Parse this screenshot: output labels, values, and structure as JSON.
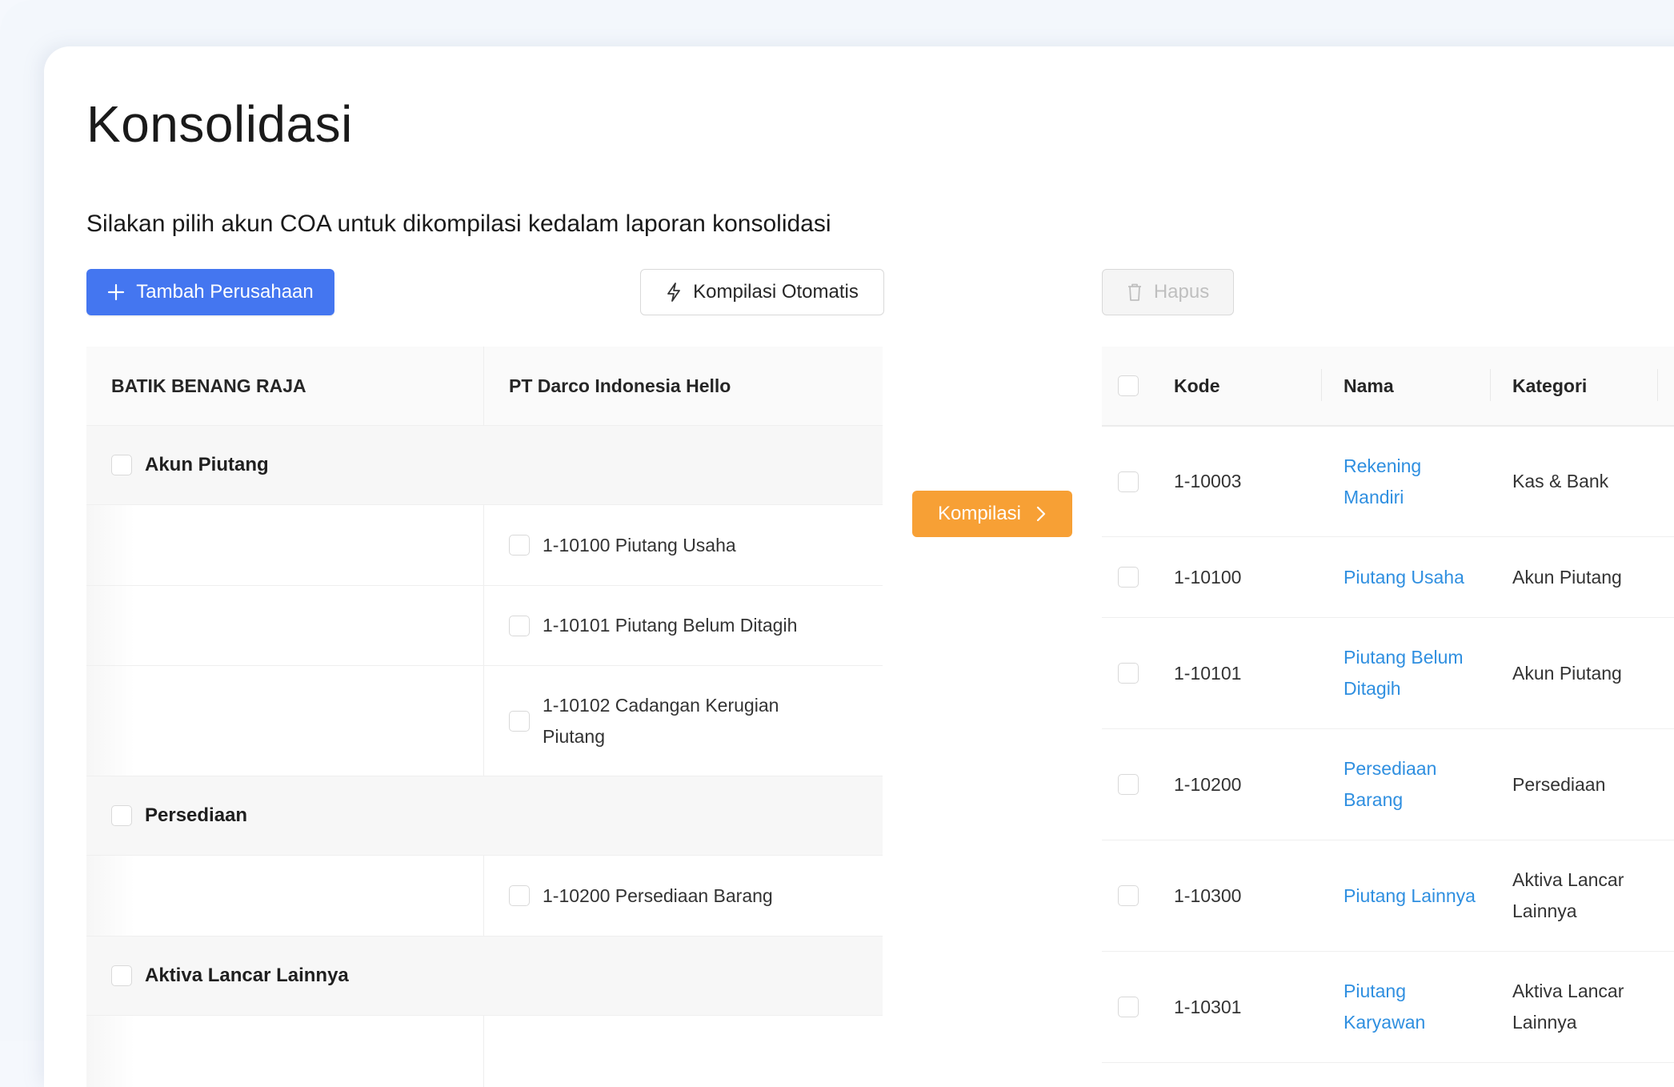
{
  "page": {
    "title": "Konsolidasi",
    "subtitle": "Silakan pilih akun COA untuk dikompilasi kedalam laporan konsolidasi"
  },
  "toolbar": {
    "add_company_label": "Tambah Perusahaan",
    "auto_compile_label": "Kompilasi Otomatis",
    "delete_label": "Hapus",
    "compile_label": "Kompilasi"
  },
  "left_table": {
    "columns": [
      "BATIK BENANG RAJA",
      "PT Darco Indonesia Hello"
    ],
    "groups": [
      {
        "name": "Akun Piutang",
        "accounts": [
          "1-10100 Piutang Usaha",
          "1-10101 Piutang Belum Ditagih",
          "1-10102 Cadangan Kerugian Piutang"
        ]
      },
      {
        "name": "Persediaan",
        "accounts": [
          "1-10200 Persediaan Barang"
        ]
      },
      {
        "name": "Aktiva Lancar Lainnya",
        "accounts": []
      }
    ]
  },
  "right_table": {
    "columns": [
      "Kode",
      "Nama",
      "Kategori"
    ],
    "rows": [
      {
        "kode": "1-10003",
        "nama": "Rekening Mandiri",
        "kategori": "Kas & Bank"
      },
      {
        "kode": "1-10100",
        "nama": "Piutang Usaha",
        "kategori": "Akun Piutang"
      },
      {
        "kode": "1-10101",
        "nama": "Piutang Belum Ditagih",
        "kategori": "Akun Piutang"
      },
      {
        "kode": "1-10200",
        "nama": "Persediaan Barang",
        "kategori": "Persediaan"
      },
      {
        "kode": "1-10300",
        "nama": "Piutang Lainnya",
        "kategori": "Aktiva Lancar Lainnya"
      },
      {
        "kode": "1-10301",
        "nama": "Piutang Karyawan",
        "kategori": "Aktiva Lancar Lainnya"
      }
    ]
  },
  "colors": {
    "primary": "#4476f0",
    "accent_orange": "#f7a035",
    "link": "#2f8fe0"
  },
  "icons": {
    "add": "plus-icon",
    "auto_compile": "lightning-icon",
    "delete": "trash-icon",
    "compile": "chevron-right-icon"
  }
}
